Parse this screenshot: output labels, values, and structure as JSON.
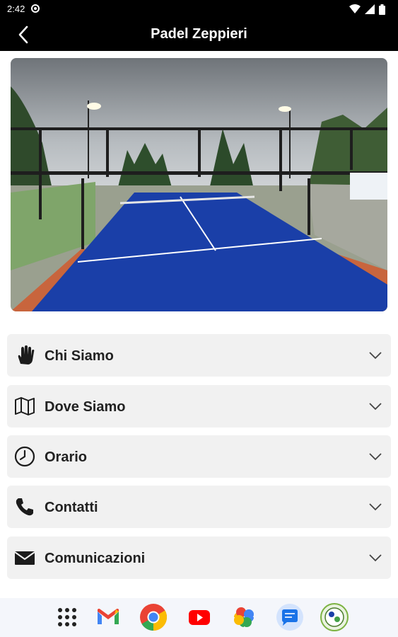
{
  "status_bar": {
    "time": "2:42"
  },
  "header": {
    "title": "Padel Zeppieri"
  },
  "sections": [
    {
      "label": "Chi Siamo",
      "icon": "hand-icon"
    },
    {
      "label": "Dove Siamo",
      "icon": "map-icon"
    },
    {
      "label": "Orario",
      "icon": "clock-icon"
    },
    {
      "label": "Contatti",
      "icon": "phone-icon"
    },
    {
      "label": "Comunicazioni",
      "icon": "envelope-icon"
    }
  ],
  "dock": {
    "apps": [
      "app-drawer",
      "gmail",
      "chrome",
      "youtube",
      "photos",
      "messages",
      "padel-app"
    ]
  },
  "colors": {
    "bar": "#000000",
    "card": "#f1f1f1",
    "court": "#1a3fa8"
  }
}
